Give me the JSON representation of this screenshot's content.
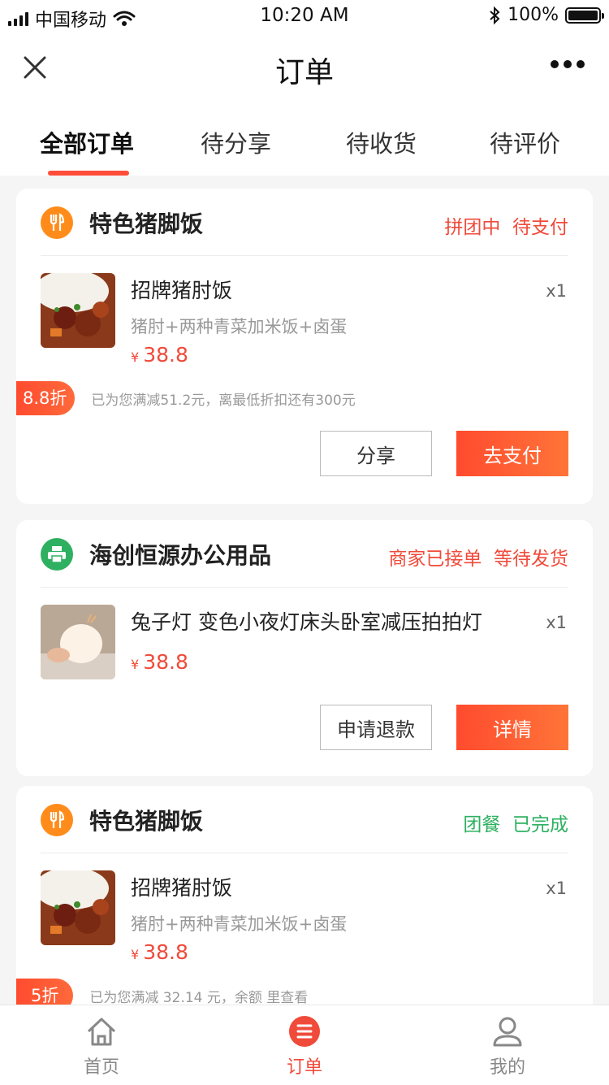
{
  "status_bar": {
    "carrier": "中国移动",
    "time": "10:20 AM",
    "battery": "100%"
  },
  "nav": {
    "title": "订单"
  },
  "tabs": [
    {
      "label": "全部订单",
      "active": true
    },
    {
      "label": "待分享"
    },
    {
      "label": "待收货"
    },
    {
      "label": "待评价"
    }
  ],
  "orders": [
    {
      "shop": "特色猪脚饭",
      "status_a": "拼团中",
      "status_b": "待支付",
      "status_color": "#f04a3a",
      "product": {
        "name": "招牌猪肘饭",
        "desc": "猪肘+两种青菜加米饭+卤蛋",
        "price_currency": "¥",
        "price": "38.8",
        "qty": "x1"
      },
      "promo": {
        "badge": "8.8折",
        "text": "已为您满减51.2元，离最低折扣还有300元"
      },
      "buttons": {
        "secondary": "分享",
        "primary": "去支付"
      }
    },
    {
      "shop": "海创恒源办公用品",
      "status_a": "商家已接单",
      "status_b": "等待发货",
      "status_color": "#f04a3a",
      "product": {
        "name": "兔子灯 变色小夜灯床头卧室减压拍拍灯",
        "price_currency": "¥",
        "price": "38.8",
        "qty": "x1"
      },
      "buttons": {
        "secondary": "申请退款",
        "primary": "详情"
      }
    },
    {
      "shop": "特色猪脚饭",
      "status_a": "团餐",
      "status_b": "已完成",
      "status_color": "#2eb060",
      "product": {
        "name": "招牌猪肘饭",
        "desc": "猪肘+两种青菜加米饭+卤蛋",
        "price_currency": "¥",
        "price": "38.8",
        "qty": "x1"
      },
      "promo": {
        "badge": "5折",
        "text": "已为您满减 32.14 元，余额 里查看"
      }
    }
  ],
  "tabbar": [
    {
      "label": "首页",
      "icon": "home-icon"
    },
    {
      "label": "订单",
      "icon": "order-icon",
      "active": true
    },
    {
      "label": "我的",
      "icon": "user-icon"
    }
  ],
  "colors": {
    "accent": "#f04a3a",
    "success": "#2eb060",
    "food_icon": "#ff8c1a",
    "office_icon": "#2eb060"
  }
}
